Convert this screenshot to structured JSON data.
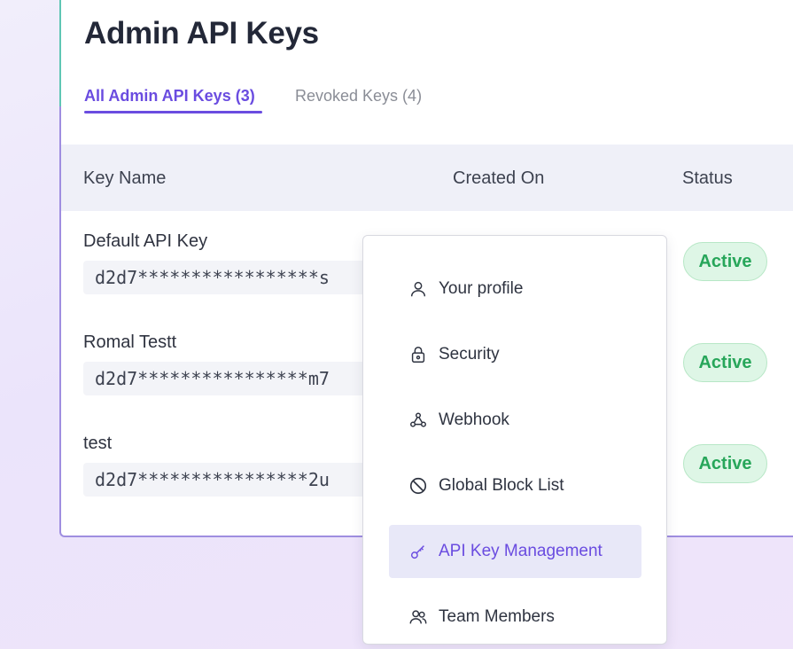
{
  "page": {
    "title": "Admin API Keys"
  },
  "tabs": [
    {
      "label": "All Admin API Keys (3)",
      "active": true
    },
    {
      "label": "Revoked Keys (4)",
      "active": false
    }
  ],
  "table": {
    "headers": {
      "name": "Key Name",
      "created": "Created On",
      "status": "Status"
    },
    "rows": [
      {
        "name": "Default API Key",
        "key": "d2d7*****************s",
        "status": "Active"
      },
      {
        "name": "Romal Testt",
        "key": "d2d7****************m7",
        "status": "Active"
      },
      {
        "name": "test",
        "key": "d2d7****************2u",
        "status": "Active"
      }
    ]
  },
  "menu": {
    "items": [
      {
        "label": "Your profile",
        "icon": "user-icon"
      },
      {
        "label": "Security",
        "icon": "lock-icon"
      },
      {
        "label": "Webhook",
        "icon": "webhook-icon"
      },
      {
        "label": "Global Block List",
        "icon": "block-icon"
      },
      {
        "label": "API Key Management",
        "icon": "key-icon",
        "active": true
      },
      {
        "label": "Team Members",
        "icon": "team-icon"
      }
    ]
  },
  "colors": {
    "accent": "#6a4ce0",
    "status_active_text": "#27a65a",
    "status_active_bg": "#def6e6",
    "menu_active_bg": "#e8e8f8"
  }
}
